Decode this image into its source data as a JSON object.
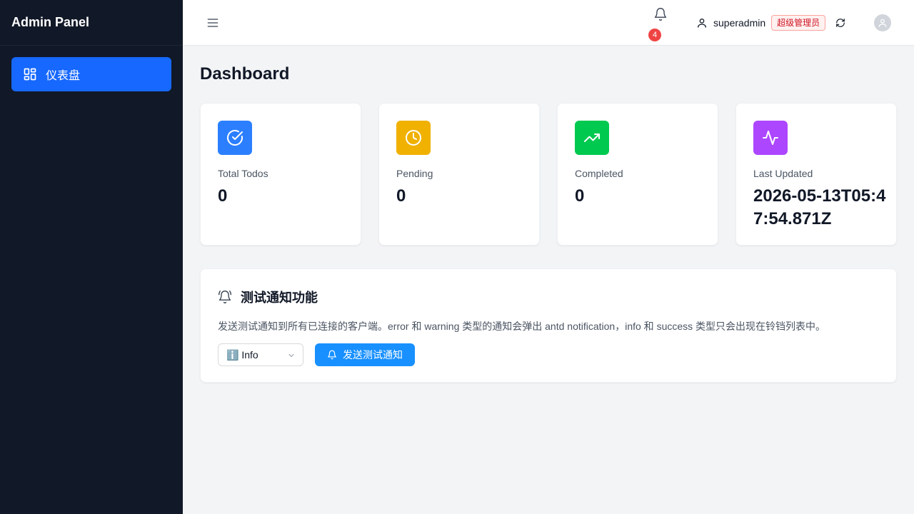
{
  "app": {
    "brand": "Admin Panel"
  },
  "sidebar": {
    "items": [
      {
        "label": "仪表盘",
        "icon": "dashboard-grid-icon",
        "active": true
      }
    ]
  },
  "header": {
    "notifications_count": "4",
    "username": "superadmin",
    "role": "超级管理员"
  },
  "page": {
    "title": "Dashboard"
  },
  "stats": [
    {
      "label": "Total Todos",
      "value": "0",
      "icon": "check-circle-icon",
      "color": "#2b7fff"
    },
    {
      "label": "Pending",
      "value": "0",
      "icon": "clock-icon",
      "color": "#f0b100"
    },
    {
      "label": "Completed",
      "value": "0",
      "icon": "trending-up-icon",
      "color": "#00c950"
    },
    {
      "label": "Last Updated",
      "value": "2026-05-13T05:47:54.871Z",
      "icon": "activity-icon",
      "color": "#ad46ff"
    }
  ],
  "notify_panel": {
    "title": "测试通知功能",
    "description": "发送测试通知到所有已连接的客户端。error 和 warning 类型的通知会弹出 antd notification，info 和 success 类型只会出现在铃铛列表中。",
    "select_value": "ℹ️ Info",
    "send_label": "发送测试通知"
  },
  "colors": {
    "sidebar_bg": "#111827",
    "primary": "#1668fe",
    "button": "#1890ff",
    "badge": "#ef4444"
  }
}
